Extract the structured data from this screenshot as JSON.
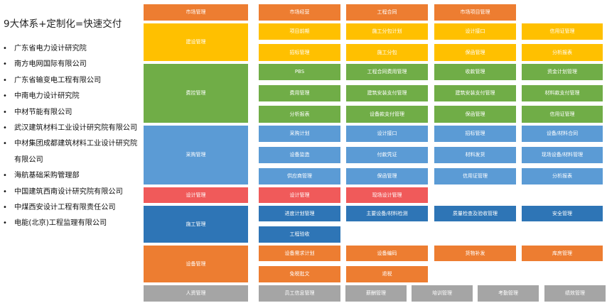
{
  "title": "9大体系+定制化=快速交付",
  "companies": [
    "广东省电力设计研究院",
    "南方电网国际有限公司",
    "广东省输变电工程有限公司",
    "中南电力设计研究院",
    "中材节能有限公司",
    "武汉建筑材料工业设计研究院有限公司",
    "中材集团成都建筑材料工业设计研究院有限公司",
    "海航基础采购管理部",
    "中国建筑西南设计研究院有限公司",
    "中煤西安设计工程有限责任公司",
    "电能(北京)工程监理有限公司"
  ],
  "categories": {
    "market": "市场管理",
    "construction_setup": "建设管理",
    "budget_control": "费控管理",
    "procurement": "采购管理",
    "design": "设计管理",
    "construction": "施工管理",
    "equipment": "设备管理",
    "hr": "人资管理"
  },
  "modules": {
    "market": [
      "市场经营",
      "工程合同",
      "市场项目管理"
    ],
    "construction_setup": [
      "项目前期",
      "施工分包计划",
      "设计接口",
      "信用证管理",
      "招标管理",
      "施工分包",
      "保函管理",
      "分析报表"
    ],
    "budget_control": [
      "PBS",
      "工程合同费用管理",
      "收款管理",
      "资金计划管理",
      "费用管理",
      "建筑安装支付管理",
      "建筑安装支付管理",
      "材料款支付管理",
      "分析报表",
      "设备款支付管理",
      "保函管理",
      "信用证管理"
    ],
    "procurement": [
      "采购计划",
      "设计接口",
      "招标管理",
      "设备/材料合同",
      "设备监造",
      "付款凭证",
      "材料发货",
      "现场设备/材料管理",
      "供应商管理",
      "保函管理",
      "信用证管理",
      "分析报表"
    ],
    "design": [
      "设计管理",
      "现场设计管理"
    ],
    "construction": [
      "进度计划管理",
      "主要设备/材料检测",
      "质量检查及验收管理",
      "安全管理",
      "工程验收"
    ],
    "equipment": [
      "设备需求计划",
      "设备编码",
      "货物补发",
      "库房管理",
      "免税批文",
      "退税"
    ],
    "hr": [
      "员工信息管理",
      "薪酬管理",
      "培训管理",
      "考勤管理",
      "绩效管理"
    ]
  },
  "colors": {
    "orange": "#ed7d31",
    "yellow": "#ffc000",
    "green": "#70ad47",
    "light_blue": "#5b9bd5",
    "red": "#f05a5a",
    "dark_blue": "#2e75b6",
    "gray": "#a5a5a5"
  }
}
